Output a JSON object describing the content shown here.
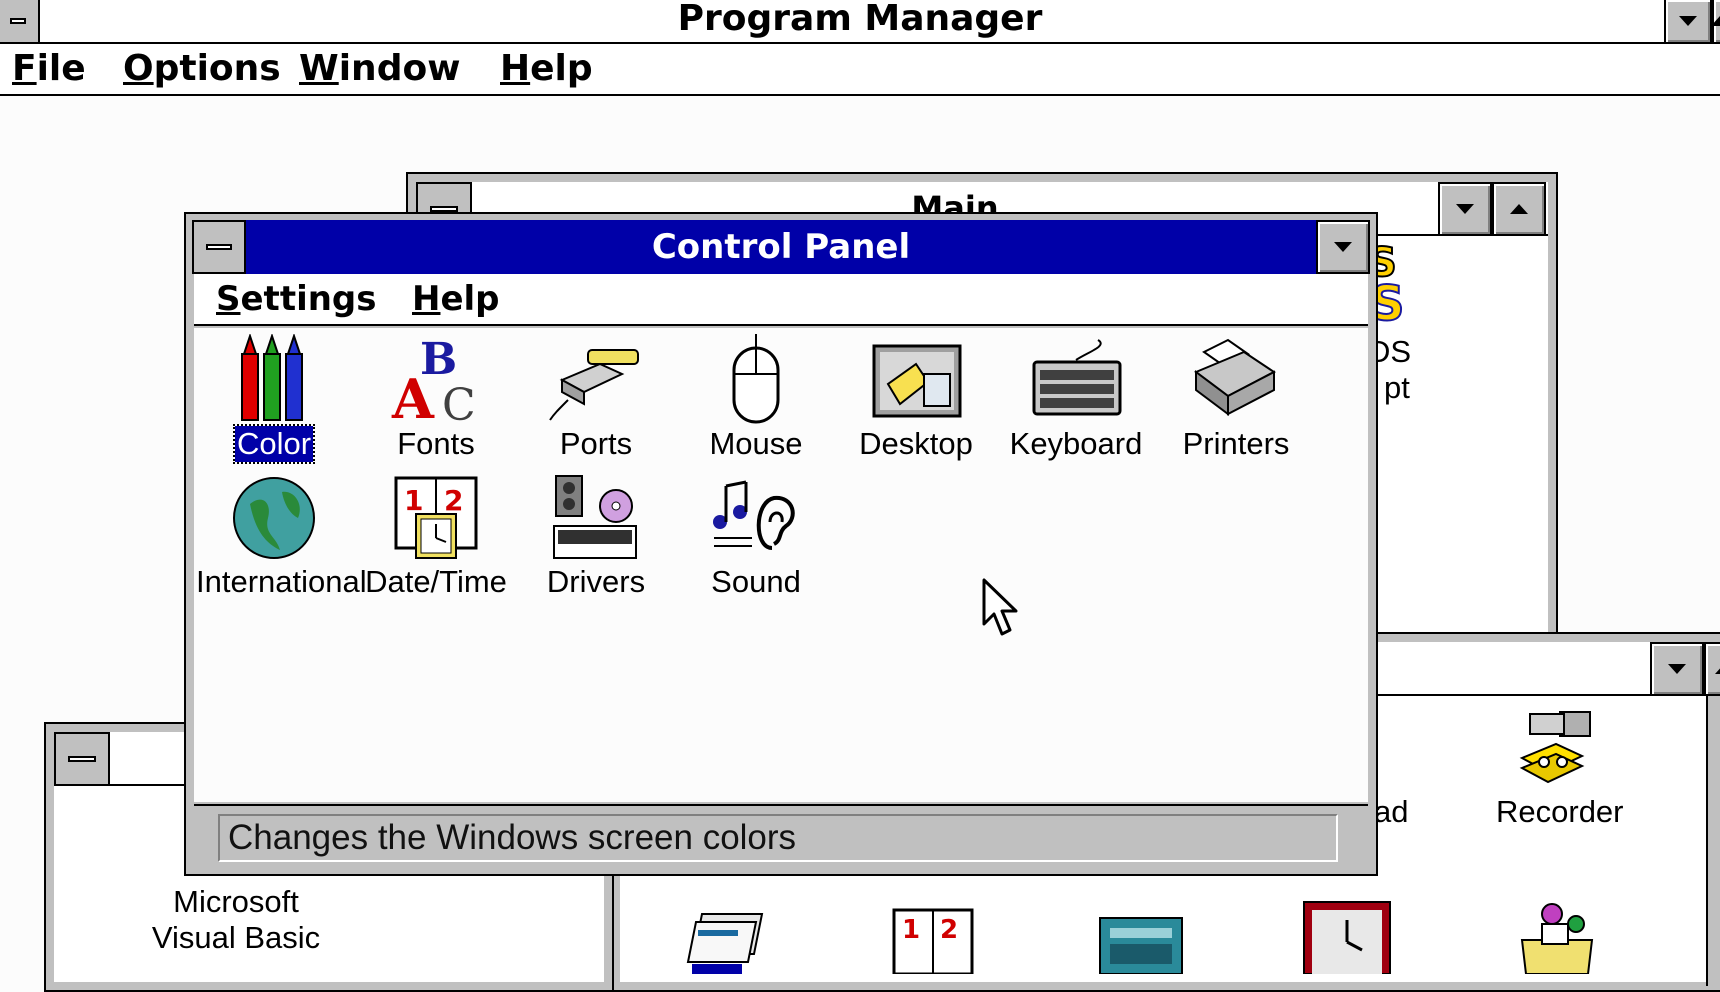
{
  "program_manager": {
    "title": "Program Manager",
    "menu": [
      {
        "label_first": "F",
        "label_rest": "ile"
      },
      {
        "label_first": "O",
        "label_rest": "ptions"
      },
      {
        "label_first": "W",
        "label_rest": "indow"
      },
      {
        "label_first": "H",
        "label_rest": "elp"
      }
    ]
  },
  "main_window": {
    "title": "Main",
    "partial_labels": [
      "DS",
      "pt"
    ]
  },
  "accessories_window": {
    "partial_label": "ad",
    "recorder_label": "Recorder"
  },
  "left_group_window": {
    "label_line1": "Microsoft",
    "label_line2": "Visual Basic"
  },
  "control_panel": {
    "title": "Control Panel",
    "menu": [
      {
        "label_first": "S",
        "label_rest": "ettings"
      },
      {
        "label_first": "H",
        "label_rest": "elp"
      }
    ],
    "icons": [
      {
        "label": "Color",
        "icon": "crayons-icon",
        "selected": true
      },
      {
        "label": "Fonts",
        "icon": "fonts-icon"
      },
      {
        "label": "Ports",
        "icon": "ports-icon"
      },
      {
        "label": "Mouse",
        "icon": "mouse-icon"
      },
      {
        "label": "Desktop",
        "icon": "desktop-icon"
      },
      {
        "label": "Keyboard",
        "icon": "keyboard-icon"
      },
      {
        "label": "Printers",
        "icon": "printer-icon"
      },
      {
        "label": "International",
        "icon": "globe-icon"
      },
      {
        "label": "Date/Time",
        "icon": "calendar-clock-icon"
      },
      {
        "label": "Drivers",
        "icon": "drivers-icon"
      },
      {
        "label": "Sound",
        "icon": "sound-icon"
      }
    ],
    "status": "Changes the Windows screen colors"
  },
  "colors": {
    "active_title": "#0000a8",
    "frame_gray": "#c0c0c0"
  }
}
